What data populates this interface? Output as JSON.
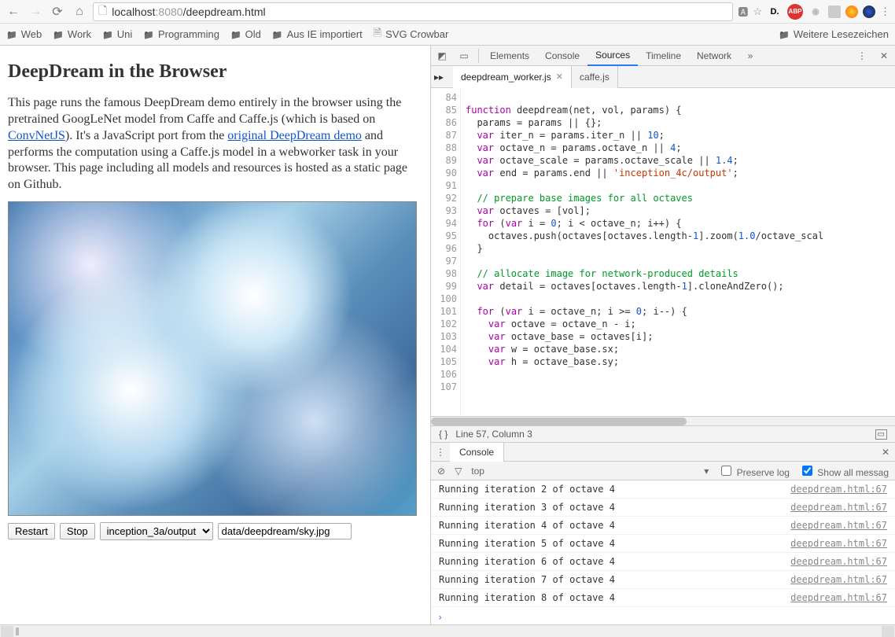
{
  "browser": {
    "url_host": "localhost",
    "url_port": ":8080",
    "url_path": "/deepdream.html"
  },
  "bookmarks": {
    "items": [
      "Web",
      "Work",
      "Uni",
      "Programming",
      "Old",
      "Aus IE importiert"
    ],
    "page_item": "SVG Crowbar",
    "more": "Weitere Lesezeichen"
  },
  "page": {
    "title": "DeepDream in the Browser",
    "p1_a": "This page runs the famous DeepDream demo entirely in the browser using the pretrained GoogLeNet model from Caffe and Caffe.js (which is based on ",
    "link1": "ConvNetJS",
    "p1_b": "). It's a JavaScript port from the ",
    "link2": "original DeepDream demo",
    "p1_c": " and performs the computation using a Caffe.js model in a webworker task in your browser. This page including all models and resources is hosted as a static page on Github.",
    "btn_restart": "Restart",
    "btn_stop": "Stop",
    "select_value": "inception_3a/output",
    "input_value": "data/deepdream/sky.jpg"
  },
  "devtools": {
    "tabs": [
      "Elements",
      "Console",
      "Sources",
      "Timeline",
      "Network"
    ],
    "active_tab": "Sources",
    "files": {
      "active": "deepdream_worker.js",
      "other": "caffe.js"
    },
    "line_start": 84,
    "line_end": 107,
    "status": "Line 57, Column 3",
    "console_tab": "Console",
    "console_top": "top",
    "preserve": "Preserve log",
    "showall": "Show all messag",
    "console": [
      {
        "msg": "Running iteration 2 of octave 4",
        "src": "deepdream.html:67"
      },
      {
        "msg": "Running iteration 3 of octave 4",
        "src": "deepdream.html:67"
      },
      {
        "msg": "Running iteration 4 of octave 4",
        "src": "deepdream.html:67"
      },
      {
        "msg": "Running iteration 5 of octave 4",
        "src": "deepdream.html:67"
      },
      {
        "msg": "Running iteration 6 of octave 4",
        "src": "deepdream.html:67"
      },
      {
        "msg": "Running iteration 7 of octave 4",
        "src": "deepdream.html:67"
      },
      {
        "msg": "Running iteration 8 of octave 4",
        "src": "deepdream.html:67"
      }
    ]
  },
  "code": {
    "l84": "",
    "l85_a": "function",
    "l85_b": " deepdream(net, vol, params) {",
    "l86": "  params = params || {};",
    "l87_a": "  ",
    "l87_b": "var",
    "l87_c": " iter_n = params.iter_n || ",
    "l87_d": "10",
    "l87_e": ";",
    "l88_a": "  ",
    "l88_b": "var",
    "l88_c": " octave_n = params.octave_n || ",
    "l88_d": "4",
    "l88_e": ";",
    "l89_a": "  ",
    "l89_b": "var",
    "l89_c": " octave_scale = params.octave_scale || ",
    "l89_d": "1.4",
    "l89_e": ";",
    "l90_a": "  ",
    "l90_b": "var",
    "l90_c": " end = params.end || ",
    "l90_d": "'inception_4c/output'",
    "l90_e": ";",
    "l91": "",
    "l92": "  // prepare base images for all octaves",
    "l93_a": "  ",
    "l93_b": "var",
    "l93_c": " octaves = [vol];",
    "l94_a": "  ",
    "l94_b": "for",
    "l94_c": " (",
    "l94_d": "var",
    "l94_e": " i = ",
    "l94_f": "0",
    "l94_g": "; i < octave_n; i++) {",
    "l95_a": "    octaves.push(octaves[octaves.length-",
    "l95_b": "1",
    "l95_c": "].zoom(",
    "l95_d": "1.0",
    "l95_e": "/octave_scal",
    "l96": "  }",
    "l97": "",
    "l98": "  // allocate image for network-produced details",
    "l99_a": "  ",
    "l99_b": "var",
    "l99_c": " detail = octaves[octaves.length-",
    "l99_d": "1",
    "l99_e": "].cloneAndZero();",
    "l100": "",
    "l101_a": "  ",
    "l101_b": "for",
    "l101_c": " (",
    "l101_d": "var",
    "l101_e": " i = octave_n; i >= ",
    "l101_f": "0",
    "l101_g": "; i--) {",
    "l102_a": "    ",
    "l102_b": "var",
    "l102_c": " octave = octave_n - i;",
    "l103_a": "    ",
    "l103_b": "var",
    "l103_c": " octave_base = octaves[i];",
    "l104_a": "    ",
    "l104_b": "var",
    "l104_c": " w = octave_base.sx;",
    "l105_a": "    ",
    "l105_b": "var",
    "l105_c": " h = octave_base.sy;",
    "l106": "",
    "l107": ""
  }
}
